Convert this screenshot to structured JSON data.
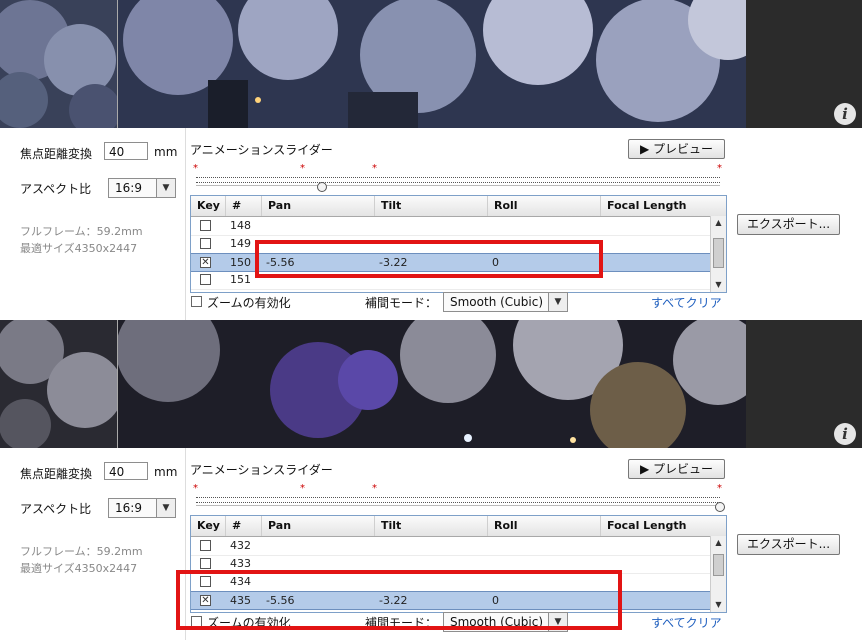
{
  "colors": {
    "highlight": "#e21414",
    "selected_row": "#b4cbe9",
    "link": "#1f5fbf",
    "keyframe_marker": "#cc0000"
  },
  "panels": [
    {
      "photo": {
        "tone": "blue-night-cherry-blossoms"
      },
      "controls": {
        "focal_label": "焦点距離変換",
        "focal_value": "40",
        "focal_unit": "mm",
        "aspect_label": "アスペクト比",
        "aspect_value": "16:9",
        "fullframe": "フルフレーム：59.2mm",
        "optimal_size": "最適サイズ4350x2447",
        "slider_title": "アニメーションスライダー",
        "preview_label": "▶ プレビュー",
        "export_label": "エクスポート...",
        "headers": [
          "Key",
          "#",
          "Pan",
          "Tilt",
          "Roll",
          "Focal Length"
        ],
        "rows": [
          {
            "checked": false,
            "num": "148",
            "pan": "",
            "tilt": "",
            "roll": "",
            "focal": ""
          },
          {
            "checked": false,
            "num": "149",
            "pan": "",
            "tilt": "",
            "roll": "",
            "focal": ""
          },
          {
            "checked": true,
            "num": "150",
            "pan": "-5.56",
            "tilt": "-3.22",
            "roll": "0",
            "focal": ""
          },
          {
            "checked": false,
            "num": "151",
            "pan": "",
            "tilt": "",
            "roll": "",
            "focal": ""
          }
        ],
        "selected_index": 2,
        "zoom_label": "ズームの有効化",
        "interp_label": "補間モード：",
        "interp_value": "Smooth (Cubic)",
        "clear_all": "すべてクリア",
        "slider_position": 0.24
      }
    },
    {
      "photo": {
        "tone": "purple-lit-cherry-blossoms"
      },
      "controls": {
        "focal_label": "焦点距離変換",
        "focal_value": "40",
        "focal_unit": "mm",
        "aspect_label": "アスペクト比",
        "aspect_value": "16:9",
        "fullframe": "フルフレーム：59.2mm",
        "optimal_size": "最適サイズ4350x2447",
        "slider_title": "アニメーションスライダー",
        "preview_label": "▶ プレビュー",
        "export_label": "エクスポート...",
        "headers": [
          "Key",
          "#",
          "Pan",
          "Tilt",
          "Roll",
          "Focal Length"
        ],
        "rows": [
          {
            "checked": false,
            "num": "432",
            "pan": "",
            "tilt": "",
            "roll": "",
            "focal": ""
          },
          {
            "checked": false,
            "num": "433",
            "pan": "",
            "tilt": "",
            "roll": "",
            "focal": ""
          },
          {
            "checked": false,
            "num": "434",
            "pan": "",
            "tilt": "",
            "roll": "",
            "focal": ""
          },
          {
            "checked": true,
            "num": "435",
            "pan": "-5.56",
            "tilt": "-3.22",
            "roll": "0",
            "focal": ""
          }
        ],
        "selected_index": 3,
        "zoom_label": "ズームの有効化",
        "interp_label": "補間モード：",
        "interp_value": "Smooth (Cubic)",
        "clear_all": "すべてクリア",
        "slider_position": 1.0
      }
    }
  ]
}
